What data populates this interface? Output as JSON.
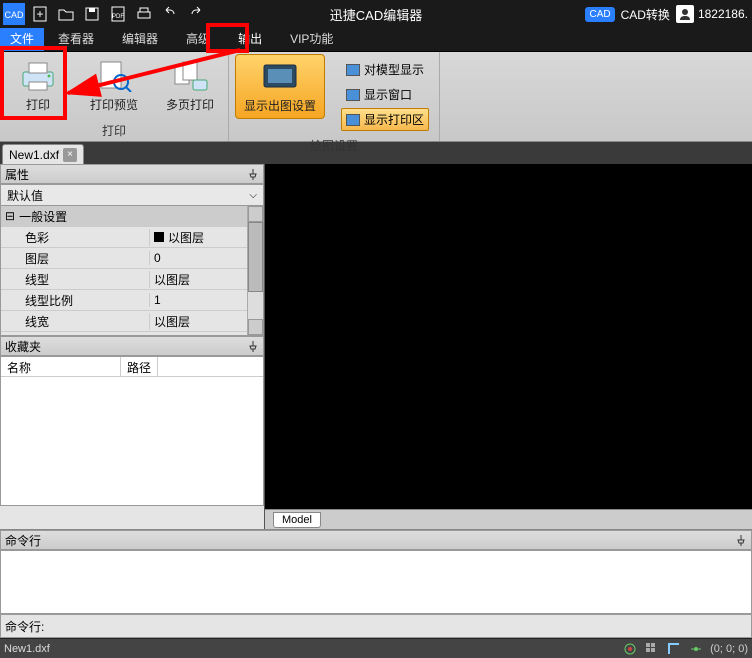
{
  "titlebar": {
    "app_icon_label": "CAD",
    "title": "迅捷CAD编辑器",
    "cad_badge": "CAD",
    "cad_convert": "CAD转换",
    "user": "1822186."
  },
  "tabs": {
    "file": "文件",
    "viewer": "查看器",
    "editor": "编辑器",
    "advanced": "高级",
    "output": "输出",
    "vip": "VIP功能"
  },
  "ribbon": {
    "print_group": {
      "print": "打印",
      "preview": "打印预览",
      "multi": "多页打印",
      "label": "打印"
    },
    "display_group": {
      "show_plot_settings": "显示出图设置",
      "model_display": "对模型显示",
      "window_display": "显示窗口",
      "print_area": "显示打印区",
      "label": "绘图设置"
    }
  },
  "doc": {
    "name": "New1.dxf"
  },
  "props": {
    "title": "属性",
    "default": "默认值",
    "section_general": "一般设置",
    "rows": [
      {
        "k": "色彩",
        "v": "以图层",
        "swatch": true
      },
      {
        "k": "图层",
        "v": "0"
      },
      {
        "k": "线型",
        "v": "以图层"
      },
      {
        "k": "线型比例",
        "v": "1"
      },
      {
        "k": "线宽",
        "v": "以图层"
      }
    ]
  },
  "fav": {
    "title": "收藏夹",
    "col_name": "名称",
    "col_path": "路径"
  },
  "model_tab": "Model",
  "cmd": {
    "title": "命令行",
    "prompt": "命令行:"
  },
  "status": {
    "file": "New1.dxf",
    "coords": "(0; 0; 0)"
  }
}
